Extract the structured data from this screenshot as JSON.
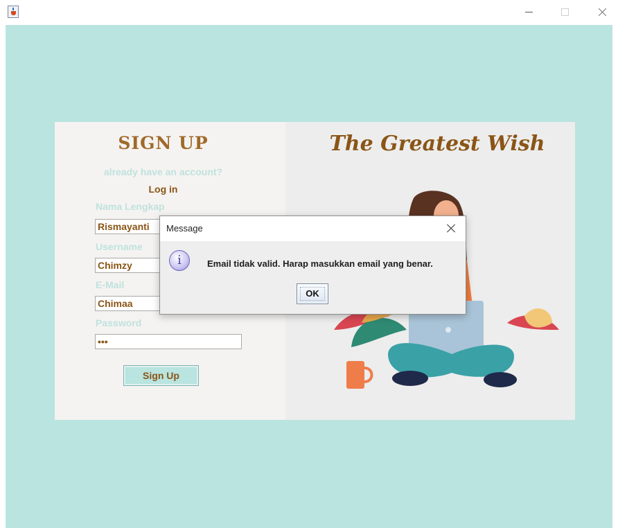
{
  "window": {
    "minimize_icon": "minimize-icon",
    "maximize_icon": "maximize-icon",
    "close_icon": "close-icon"
  },
  "form": {
    "heading": "SIGN UP",
    "hint": "already have an account?",
    "login_link": "Log in",
    "fields": [
      {
        "label": "Nama Lengkap",
        "value": "Rismayanti"
      },
      {
        "label": "Username",
        "value": "Chimzy"
      },
      {
        "label": "E-Mail",
        "value": "Chimaa"
      },
      {
        "label": "Password",
        "value": "•••"
      }
    ],
    "submit_label": "Sign Up"
  },
  "banner": {
    "title": "The Greatest Wish"
  },
  "dialog": {
    "title": "Message",
    "icon": "info-icon",
    "message": "Email tidak valid. Harap masukkan email yang benar.",
    "ok_label": "OK"
  },
  "colors": {
    "background": "#b9e4df",
    "accent_brown": "#8a5516",
    "heading_brown": "#a0692a",
    "muted_teal_text": "#bfe2de"
  }
}
